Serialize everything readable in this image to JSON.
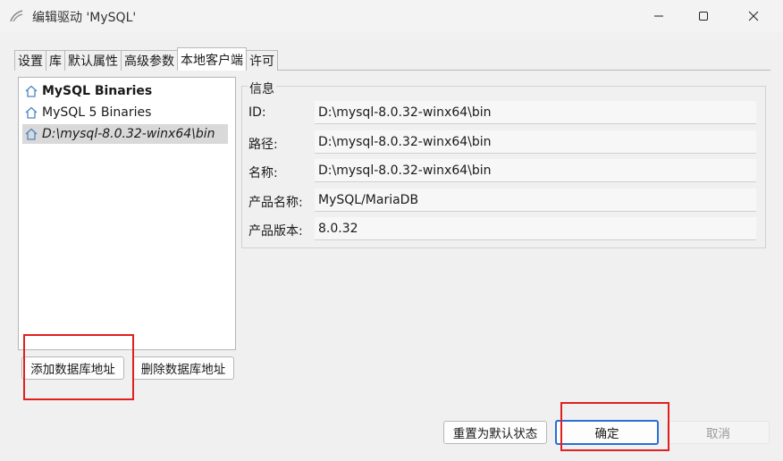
{
  "window": {
    "title": "编辑驱动 'MySQL'"
  },
  "tabs": [
    {
      "label": "设置"
    },
    {
      "label": "库"
    },
    {
      "label": "默认属性"
    },
    {
      "label": "高级参数"
    },
    {
      "label": "本地客户端",
      "active": true
    },
    {
      "label": "许可"
    }
  ],
  "clients": [
    {
      "label": "MySQL Binaries",
      "style": "bold"
    },
    {
      "label": "MySQL 5 Binaries",
      "style": "normal"
    },
    {
      "label": "D:\\mysql-8.0.32-winx64\\bin",
      "style": "italic",
      "selected": true
    }
  ],
  "left_buttons": {
    "add": "添加数据库地址",
    "remove": "删除数据库地址"
  },
  "info": {
    "legend": "信息",
    "rows": [
      {
        "label": "ID:",
        "value": "D:\\mysql-8.0.32-winx64\\bin"
      },
      {
        "label": "路径:",
        "value": "D:\\mysql-8.0.32-winx64\\bin"
      },
      {
        "label": "名称:",
        "value": "D:\\mysql-8.0.32-winx64\\bin"
      },
      {
        "label": "产品名称:",
        "value": "MySQL/MariaDB"
      },
      {
        "label": "产品版本:",
        "value": "8.0.32"
      }
    ]
  },
  "footer": {
    "reset": "重置为默认状态",
    "ok": "确定",
    "cancel": "取消"
  },
  "icons": {
    "client": "home-icon",
    "app": "dbeaver-beaver-icon"
  },
  "colors": {
    "accent": "#2a6fd6",
    "highlight_box": "#e02020",
    "home_icon": "#4a86c8"
  }
}
